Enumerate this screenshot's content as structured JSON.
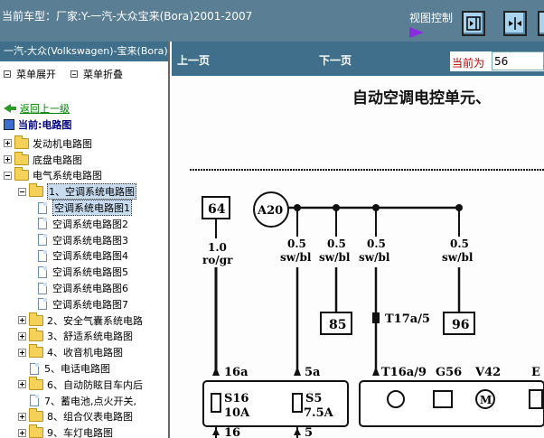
{
  "topbar": {
    "title": "当前车型：厂家:Y-一汽-大众宝来(Bora)2001-2007",
    "view_control": "视图控制"
  },
  "sidebar": {
    "header": "一汽-大众(Volkswagen)-宝来(Bora)",
    "expand": "菜单展开",
    "collapse": "菜单折叠",
    "back": "返回上一级",
    "current": "当前:电路图",
    "tree": [
      {
        "label": "发动机电路图",
        "level": 0,
        "kind": "folder",
        "toggle": "plus"
      },
      {
        "label": "底盘电路图",
        "level": 0,
        "kind": "folder",
        "toggle": "plus"
      },
      {
        "label": "电气系统电路图",
        "level": 0,
        "kind": "folder",
        "toggle": "minus"
      },
      {
        "label": "1、空调系统电路图",
        "level": 1,
        "kind": "folder",
        "toggle": "minus",
        "selected": true
      },
      {
        "label": "空调系统电路图1",
        "level": 2,
        "kind": "page",
        "selected": true
      },
      {
        "label": "空调系统电路图2",
        "level": 2,
        "kind": "page"
      },
      {
        "label": "空调系统电路图3",
        "level": 2,
        "kind": "page"
      },
      {
        "label": "空调系统电路图4",
        "level": 2,
        "kind": "page"
      },
      {
        "label": "空调系统电路图5",
        "level": 2,
        "kind": "page"
      },
      {
        "label": "空调系统电路图6",
        "level": 2,
        "kind": "page"
      },
      {
        "label": "空调系统电路图7",
        "level": 2,
        "kind": "page"
      },
      {
        "label": "2、安全气囊系统电路",
        "level": 1,
        "kind": "folder",
        "toggle": "plus"
      },
      {
        "label": "3、舒适系统电路图",
        "level": 1,
        "kind": "folder",
        "toggle": "plus"
      },
      {
        "label": "4、收音机电路图",
        "level": 1,
        "kind": "folder",
        "toggle": "plus"
      },
      {
        "label": "5、电话电路图",
        "level": 1,
        "kind": "page"
      },
      {
        "label": "6、自动防眩目车内后",
        "level": 1,
        "kind": "folder",
        "toggle": "plus"
      },
      {
        "label": "7、蓄电池,点火开关,",
        "level": 1,
        "kind": "page"
      },
      {
        "label": "8、组合仪表电路图",
        "level": 1,
        "kind": "folder",
        "toggle": "plus"
      },
      {
        "label": "9、车灯电路图",
        "level": 1,
        "kind": "folder",
        "toggle": "plus"
      }
    ]
  },
  "navbar": {
    "prev": "上一页",
    "next": "下一页",
    "current_label": "当前为",
    "current_value": "56"
  },
  "diagram": {
    "heading": "自动空调电控单元、",
    "labels": {
      "c64": "64",
      "a20": "A20",
      "w1": "1.0",
      "w1c": "ro/gr",
      "w2": "0.5",
      "w2c": "sw/bl",
      "w3": "0.5",
      "w3c": "sw/bl",
      "w4": "0.5",
      "w4c": "sw/bl",
      "w5": "0.5",
      "w5c": "sw/bl",
      "c85": "85",
      "t17": "T17a/5",
      "c96": "96",
      "p16a": "16a",
      "p5a": "5a",
      "t16": "T16a/9",
      "g56": "G56",
      "v42": "V42",
      "e": "E",
      "s16": "S16",
      "s16a": "10A",
      "s5": "S5",
      "s5a": "7.5A",
      "b16": "16",
      "b5": "5"
    }
  }
}
